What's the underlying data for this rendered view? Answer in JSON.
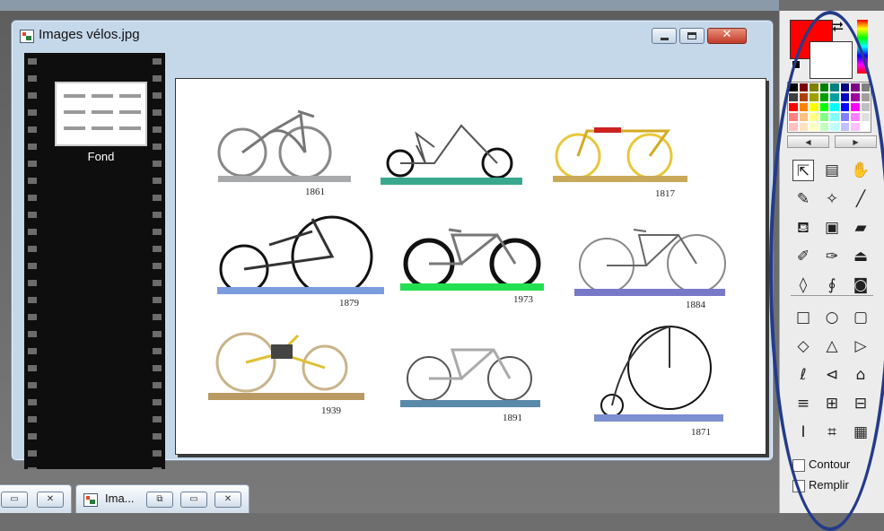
{
  "document": {
    "title": "Images vélos.jpg",
    "layer_name": "Fond",
    "bike_years": [
      "1861",
      "1817",
      "1879",
      "1973",
      "1884",
      "1939",
      "1891",
      "1871"
    ]
  },
  "tools_panel": {
    "primary_color": "#ff0000",
    "secondary_color": "#ffffff",
    "contour_label": "Contour",
    "fill_label": "Remplir"
  },
  "taskbar": {
    "minimized_tab_title": "Ima..."
  }
}
